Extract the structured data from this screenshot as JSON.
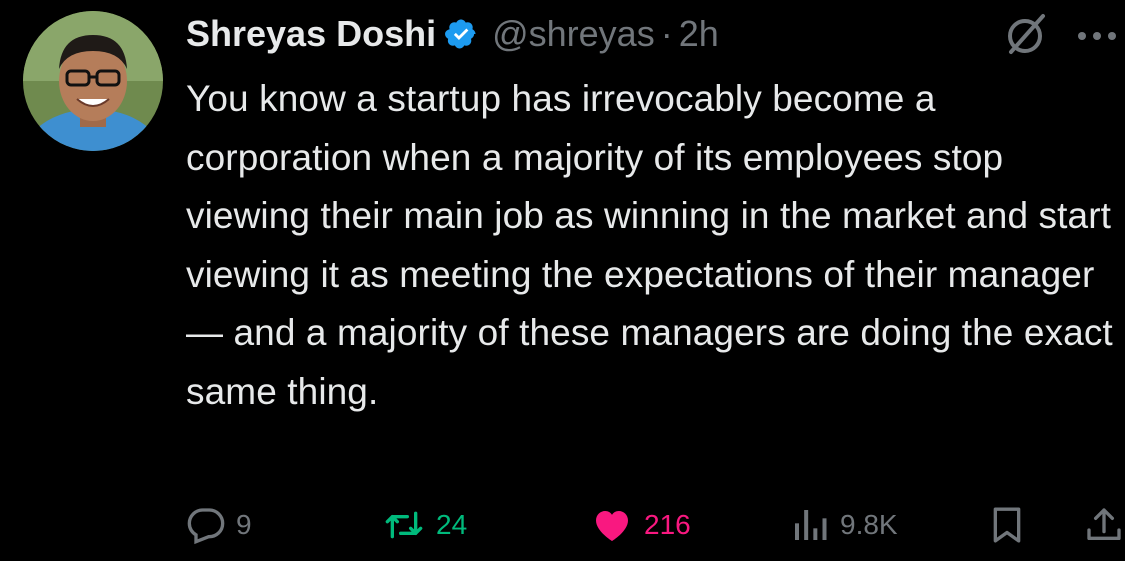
{
  "author": {
    "display_name": "Shreyas Doshi",
    "handle": "@shreyas",
    "separator": "·",
    "timestamp": "2h",
    "verified": true
  },
  "tweet": {
    "text": "You know a startup has irrevocably become a corporation when a majority of its employees stop viewing their main job as winning in the market and start viewing it as meeting the expectations of their manager — and a majority of these managers are doing the exact same thing."
  },
  "actions": {
    "replies": "9",
    "reposts": "24",
    "likes": "216",
    "views": "9.8K"
  },
  "colors": {
    "background": "#000000",
    "text": "#e7e9ea",
    "muted": "#71767b",
    "verified": "#1d9bf0",
    "repost": "#00ba7c",
    "like": "#f91880"
  },
  "icons": [
    "verified-badge-icon",
    "grok-icon",
    "more-icon",
    "reply-icon",
    "repost-icon",
    "like-icon",
    "views-icon",
    "bookmark-icon",
    "share-icon"
  ]
}
